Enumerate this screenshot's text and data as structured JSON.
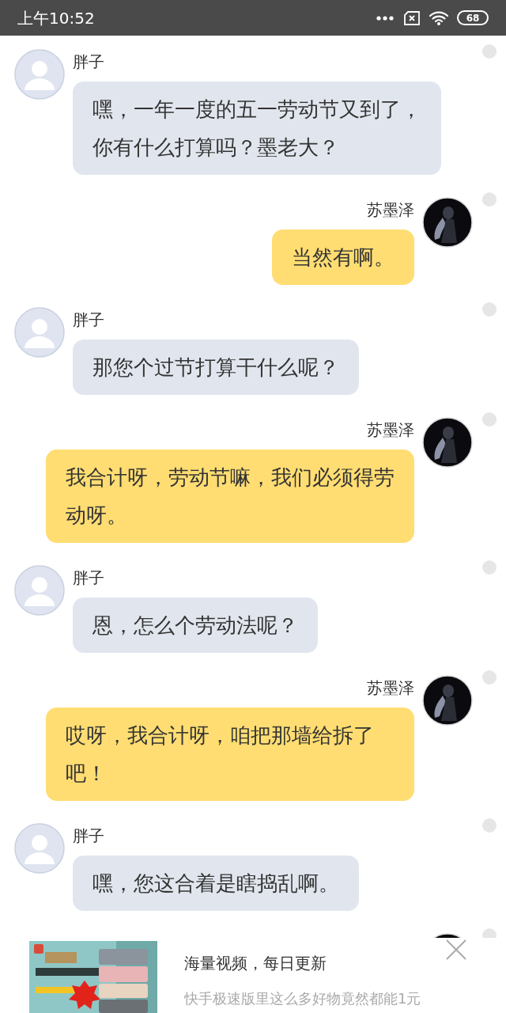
{
  "status_bar": {
    "time": "上午10:52",
    "battery": "68"
  },
  "messages": [
    {
      "kind": "incoming",
      "name": "胖子",
      "text": "嘿，一年一度的五一劳动节又到了，你有什么打算吗？墨老大？"
    },
    {
      "kind": "outgoing",
      "name": "苏墨泽",
      "text": "当然有啊。"
    },
    {
      "kind": "incoming",
      "name": "胖子",
      "text": "那您个过节打算干什么呢？"
    },
    {
      "kind": "outgoing",
      "name": "苏墨泽",
      "text": "我合计呀，劳动节嘛，我们必须得劳动呀。"
    },
    {
      "kind": "incoming",
      "name": "胖子",
      "text": "恩，怎么个劳动法呢？"
    },
    {
      "kind": "outgoing",
      "name": "苏墨泽",
      "text": "哎呀，我合计呀，咱把那墙给拆了吧！"
    },
    {
      "kind": "incoming",
      "name": "胖子",
      "text": "嘿，您这合着是瞎捣乱啊。"
    },
    {
      "kind": "outgoing"
    }
  ],
  "ad": {
    "kind": "picture",
    "title": "海量视频，每日更新",
    "description": "快手极速版里这么多好物竟然都能1元"
  }
}
